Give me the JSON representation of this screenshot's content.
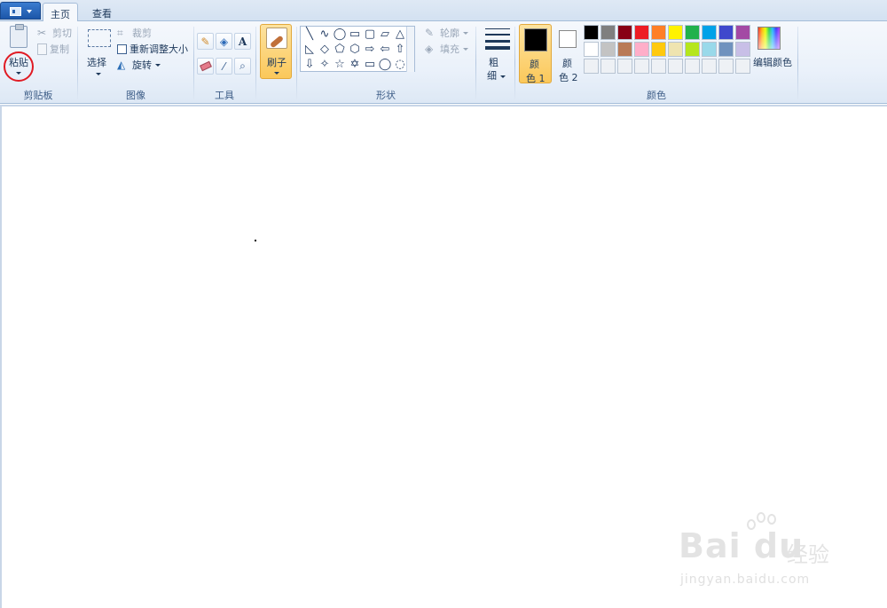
{
  "tabs": {
    "home": "主页",
    "view": "查看"
  },
  "clipboard": {
    "paste": "粘贴",
    "cut": "剪切",
    "copy": "复制",
    "group": "剪贴板"
  },
  "image": {
    "select": "选择",
    "crop": "裁剪",
    "resize": "重新调整大小",
    "rotate": "旋转",
    "group": "图像"
  },
  "tools": {
    "group": "工具",
    "text_glyph": "A"
  },
  "brush": {
    "label": "刷子"
  },
  "shapes": {
    "outline": "轮廓",
    "fill": "填充",
    "group": "形状",
    "row1": [
      "╲",
      "∿",
      "◯",
      "▭",
      "▢",
      "▱",
      "△"
    ],
    "row2": [
      "◺",
      "◇",
      "⬠",
      "⬡",
      "⇨",
      "⇦",
      "⇧"
    ],
    "row3": [
      "⇩",
      "✧",
      "☆",
      "✡",
      "▭",
      "◯",
      "◌"
    ]
  },
  "size": {
    "label1": "粗",
    "label2": "细"
  },
  "colors": {
    "color1_label1": "颜",
    "color1_label2": "色 1",
    "color2_label1": "颜",
    "color2_label2": "色 2",
    "edit": "编辑颜色",
    "group": "颜色",
    "color1_value": "#000000",
    "color2_value": "#ffffff",
    "palette_row1": [
      "#000000",
      "#7f7f7f",
      "#880015",
      "#ed1c24",
      "#ff7f27",
      "#fff200",
      "#22b14c",
      "#00a2e8",
      "#3f48cc",
      "#a349a4"
    ],
    "palette_row2": [
      "#ffffff",
      "#c3c3c3",
      "#b97a57",
      "#ffaec9",
      "#ffc90e",
      "#efe4b0",
      "#b5e61d",
      "#99d9ea",
      "#7092be",
      "#c8bfe7"
    ],
    "palette_row3": [
      "#eef1f5",
      "#eef1f5",
      "#eef1f5",
      "#eef1f5",
      "#eef1f5",
      "#eef1f5",
      "#eef1f5",
      "#eef1f5",
      "#eef1f5",
      "#eef1f5"
    ]
  },
  "watermark": {
    "brand": "Bai du",
    "cn": "经验",
    "url": "jingyan.baidu.com"
  }
}
